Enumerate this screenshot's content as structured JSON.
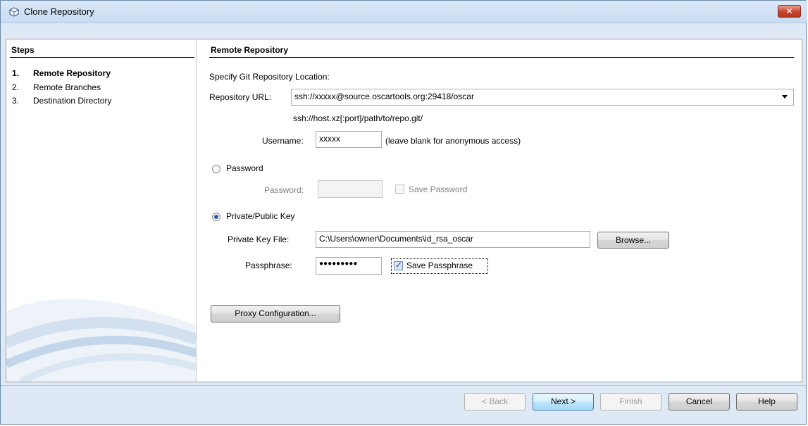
{
  "window": {
    "title": "Clone Repository",
    "close_icon": "✕"
  },
  "steps": {
    "title": "Steps",
    "items": [
      {
        "num": "1.",
        "label": "Remote Repository",
        "active": true
      },
      {
        "num": "2.",
        "label": "Remote Branches",
        "active": false
      },
      {
        "num": "3.",
        "label": "Destination Directory",
        "active": false
      }
    ]
  },
  "main": {
    "section_title": "Remote Repository",
    "intro": "Specify Git Repository Location:",
    "repository_url_label": "Repository URL:",
    "repository_url_value": "ssh://xxxxx@source.oscartools.org:29418/oscar",
    "url_hint": "ssh://host.xz[:port]/path/to/repo.git/",
    "username_label": "Username:",
    "username_value": "xxxxx",
    "username_hint": "(leave blank for anonymous access)",
    "password_radio_label": "Password",
    "password_label": "Password:",
    "password_value": "",
    "save_password_label": "Save Password",
    "key_radio_label": "Private/Public Key",
    "private_key_file_label": "Private Key File:",
    "private_key_file_value": "C:\\Users\\owner\\Documents\\id_rsa_oscar",
    "browse_label": "Browse...",
    "passphrase_label": "Passphrase:",
    "passphrase_value": "●●●●●●●●●",
    "save_passphrase_label": "Save Passphrase",
    "proxy_label": "Proxy Configuration..."
  },
  "footer": {
    "back_label": "< Back",
    "next_label": "Next >",
    "finish_label": "Finish",
    "cancel_label": "Cancel",
    "help_label": "Help"
  }
}
